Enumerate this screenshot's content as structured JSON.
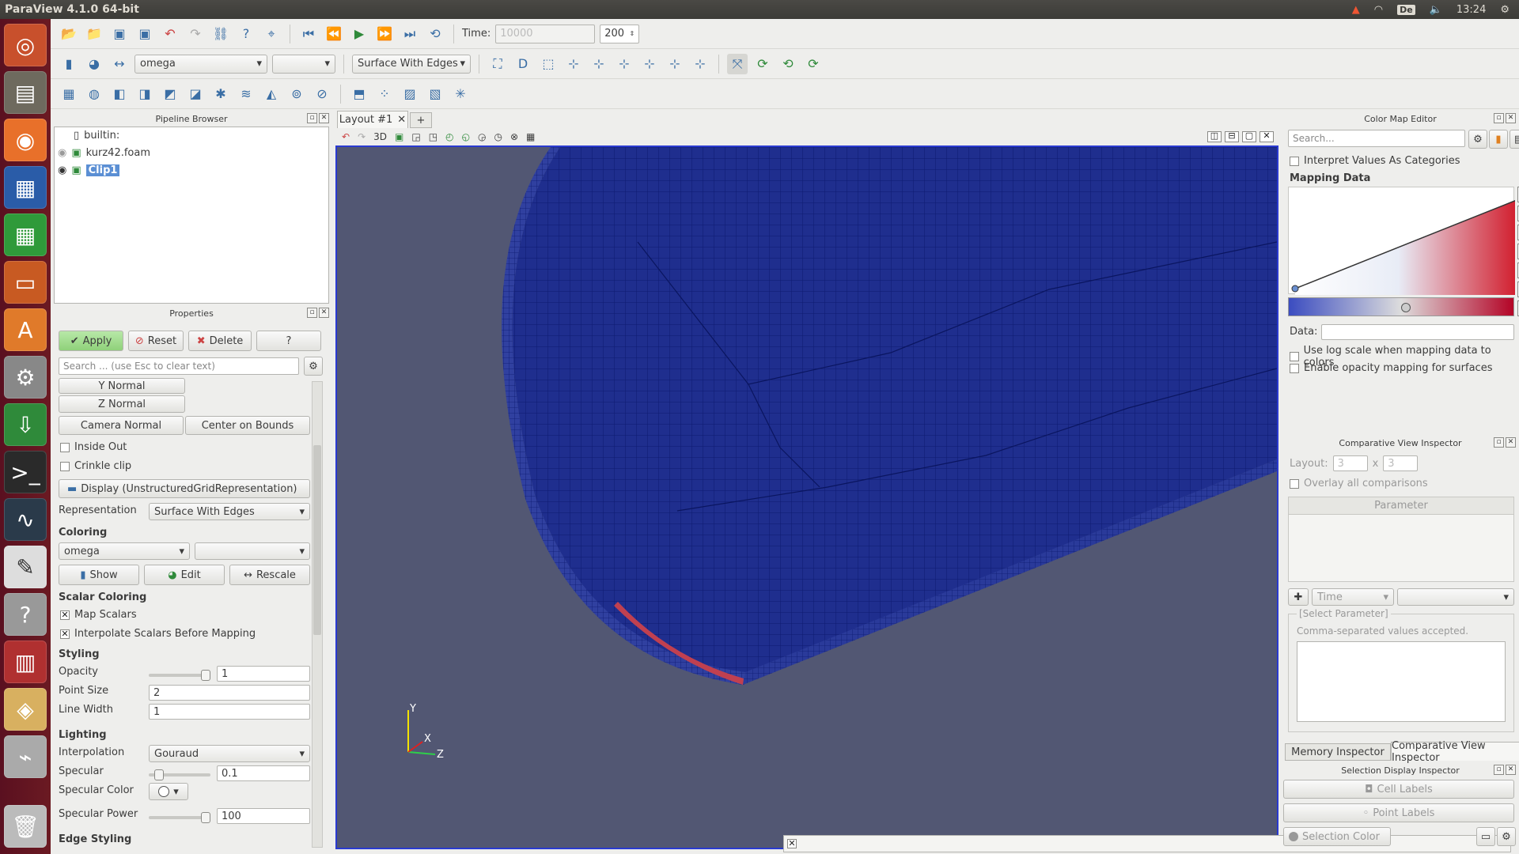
{
  "window": {
    "title": "ParaView 4.1.0 64-bit"
  },
  "tray": {
    "keyboard": "De",
    "clock": "13:24"
  },
  "toolbar1": {
    "time_label": "Time:",
    "time_value": "10000",
    "timestep": "200"
  },
  "toolbar2": {
    "array": "omega",
    "component": "",
    "representation": "Surface With Edges",
    "axis_label": "D"
  },
  "pipeline": {
    "title": "Pipeline Browser",
    "items": [
      {
        "label": "builtin:"
      },
      {
        "label": "kurz42.foam"
      },
      {
        "label": "Clip1"
      }
    ]
  },
  "properties": {
    "title": "Properties",
    "apply": "Apply",
    "reset": "Reset",
    "delete": "Delete",
    "help": "?",
    "search_placeholder": "Search ... (use Esc to clear text)",
    "y_normal": "Y Normal",
    "z_normal": "Z Normal",
    "camera_normal": "Camera Normal",
    "center_on_bounds": "Center on Bounds",
    "inside_out": "Inside Out",
    "crinkle_clip": "Crinkle clip",
    "display_header": "Display (UnstructuredGridRepresentation)",
    "representation_label": "Representation",
    "representation_value": "Surface With Edges",
    "coloring": "Coloring",
    "coloring_array": "omega",
    "coloring_component": "",
    "show": "Show",
    "edit": "Edit",
    "rescale": "Rescale",
    "scalar_coloring": "Scalar Coloring",
    "map_scalars": "Map Scalars",
    "interpolate_scalars": "Interpolate Scalars Before Mapping",
    "styling": "Styling",
    "opacity_label": "Opacity",
    "opacity": "1",
    "opacity_level": 1.0,
    "point_size_label": "Point Size",
    "point_size": "2",
    "line_width_label": "Line Width",
    "line_width": "1",
    "lighting": "Lighting",
    "interpolation_label": "Interpolation",
    "interpolation": "Gouraud",
    "specular_label": "Specular",
    "specular": "0.1",
    "specular_level": 0.1,
    "specular_color_label": "Specular Color",
    "specular_power_label": "Specular Power",
    "specular_power": "100",
    "specular_power_level": 1.0,
    "edge_styling": "Edge Styling"
  },
  "layout": {
    "tab": "Layout #1",
    "add": "+",
    "mode": "3D"
  },
  "axes": {
    "x": "X",
    "y": "Y",
    "z": "Z"
  },
  "colormap": {
    "title": "Color Map Editor",
    "search_placeholder": "Search...",
    "interpret": "Interpret Values As Categories",
    "mapping": "Mapping Data",
    "data_label": "Data:",
    "data_value": "",
    "log_scale": "Use log scale when mapping data to colors",
    "opacity_mapping": "Enable opacity mapping for surfaces"
  },
  "comparative": {
    "title": "Comparative View Inspector",
    "layout_label": "Layout:",
    "layout_x": "3",
    "times": "x",
    "layout_y": "3",
    "overlay": "Overlay all comparisons",
    "parameter": "Parameter",
    "time": "Time",
    "select_parameter": "[Select Parameter]",
    "csv_hint": "Comma-separated values accepted."
  },
  "bottom_tabs": {
    "memory": "Memory Inspector",
    "comparative": "Comparative View Inspector"
  },
  "selection": {
    "title": "Selection Display Inspector",
    "cell_labels": "Cell Labels",
    "point_labels": "Point Labels",
    "selection_color": "Selection Color"
  },
  "colors": {
    "accent": "#3a6ea5",
    "viewport_bg": "#525773",
    "mesh_blue": "#1b2a8a",
    "apply_green": "#8fd17a"
  }
}
